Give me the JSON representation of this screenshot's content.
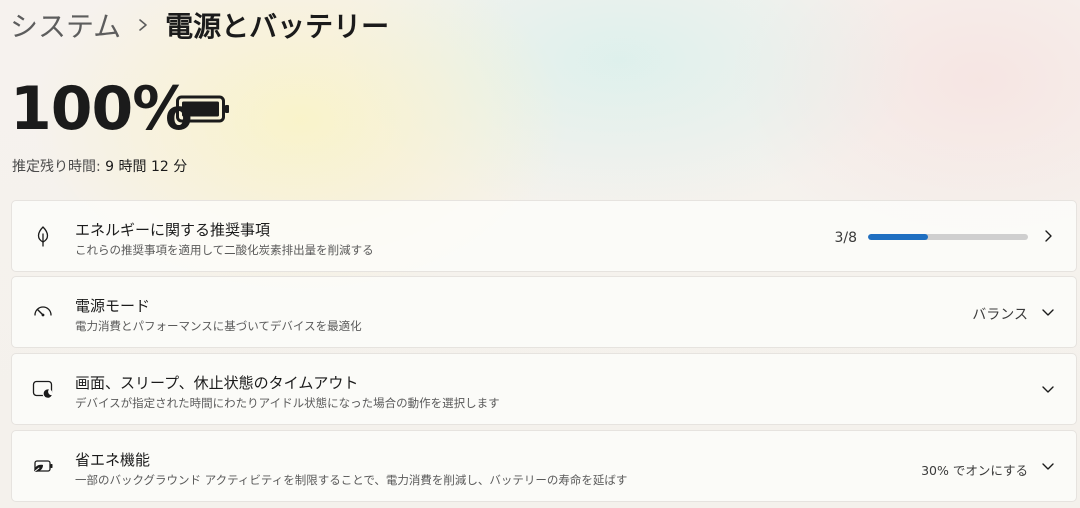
{
  "breadcrumb": {
    "parent": "システム",
    "current": "電源とバッテリー"
  },
  "battery": {
    "percent": "100%",
    "icon": "battery-full-icon",
    "remaining_label": "推定残り時間:",
    "remaining_value": "9 時間 12 分"
  },
  "settings": [
    {
      "icon": "leaf-icon",
      "title": "エネルギーに関する推奨事項",
      "subtitle": "これらの推奨事項を適用して二酸化炭素排出量を削減する",
      "progress_text": "3/8",
      "progress_value": 0.375
    },
    {
      "icon": "power-mode-gauge-icon",
      "title": "電源モード",
      "subtitle": "電力消費とパフォーマンスに基づいてデバイスを最適化",
      "value": "バランス"
    },
    {
      "icon": "screen-sleep-icon",
      "title": "画面、スリープ、休止状態のタイムアウト",
      "subtitle": "デバイスが指定された時間にわたりアイドル状態になった場合の動作を選択します",
      "value": ""
    },
    {
      "icon": "battery-saver-icon",
      "title": "省エネ機能",
      "subtitle": "一部のバックグラウンド アクティビティを制限することで、電力消費を削減し、バッテリーの寿命を延ばす",
      "value": "30% でオンにする"
    }
  ],
  "colors": {
    "accent": "#1f6fc1",
    "track": "#cfcfcf",
    "text": "#1b1b1b",
    "subtext": "#5a5a5a"
  }
}
